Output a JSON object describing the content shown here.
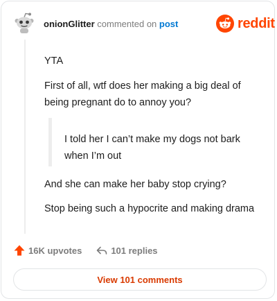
{
  "header": {
    "username": "onionGlitter",
    "commented_on": "commented on",
    "post_link": "post"
  },
  "brand": {
    "wordmark": "reddit",
    "logo_icon": "reddit-snoo-icon",
    "color": "#ff4500"
  },
  "avatar": {
    "icon": "snoo-avatar-icon"
  },
  "comment": {
    "line1": "YTA",
    "line2": "First of all, wtf does her making a big deal of being pregnant do to annoy you?",
    "quote": "I told her I can’t make my dogs not bark when I’m out",
    "line3": "And she can make her baby stop crying?",
    "line4": "Stop being such a hypocrite and making drama"
  },
  "actions": {
    "upvotes_label": "16K upvotes",
    "upvote_icon": "upvote-arrow-icon",
    "upvote_color": "#ff4500",
    "replies_label": "101 replies",
    "reply_icon": "reply-arrow-icon"
  },
  "view_button": {
    "label": "View 101 comments",
    "color": "#d93a00"
  }
}
